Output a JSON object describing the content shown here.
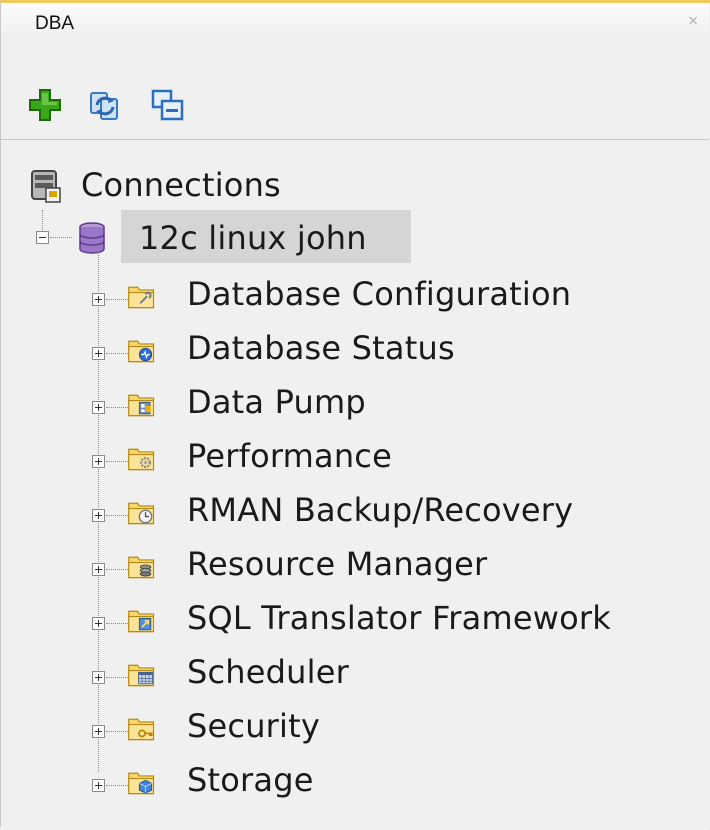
{
  "panel": {
    "title": "DBA",
    "close_glyph": "×"
  },
  "toolbar": {
    "buttons": [
      {
        "name": "add-connection-button",
        "icon": "green-plus-icon"
      },
      {
        "name": "refresh-button",
        "icon": "refresh-icon"
      },
      {
        "name": "collapse-all-button",
        "icon": "collapse-icon"
      }
    ]
  },
  "tree": {
    "root_label": "Connections",
    "connection": {
      "label": "12c linux john",
      "expanded": true,
      "selected": true
    },
    "children": [
      {
        "label": "Database Configuration",
        "icon": "wrench-folder-icon"
      },
      {
        "label": "Database Status",
        "icon": "status-folder-icon"
      },
      {
        "label": "Data Pump",
        "icon": "datapump-folder-icon"
      },
      {
        "label": "Performance",
        "icon": "gear-folder-icon"
      },
      {
        "label": "RMAN Backup/Recovery",
        "icon": "clock-folder-icon"
      },
      {
        "label": "Resource Manager",
        "icon": "disks-folder-icon"
      },
      {
        "label": "SQL Translator Framework",
        "icon": "translator-folder-icon"
      },
      {
        "label": "Scheduler",
        "icon": "calendar-folder-icon"
      },
      {
        "label": "Security",
        "icon": "key-folder-icon"
      },
      {
        "label": "Storage",
        "icon": "cube-folder-icon"
      }
    ]
  }
}
